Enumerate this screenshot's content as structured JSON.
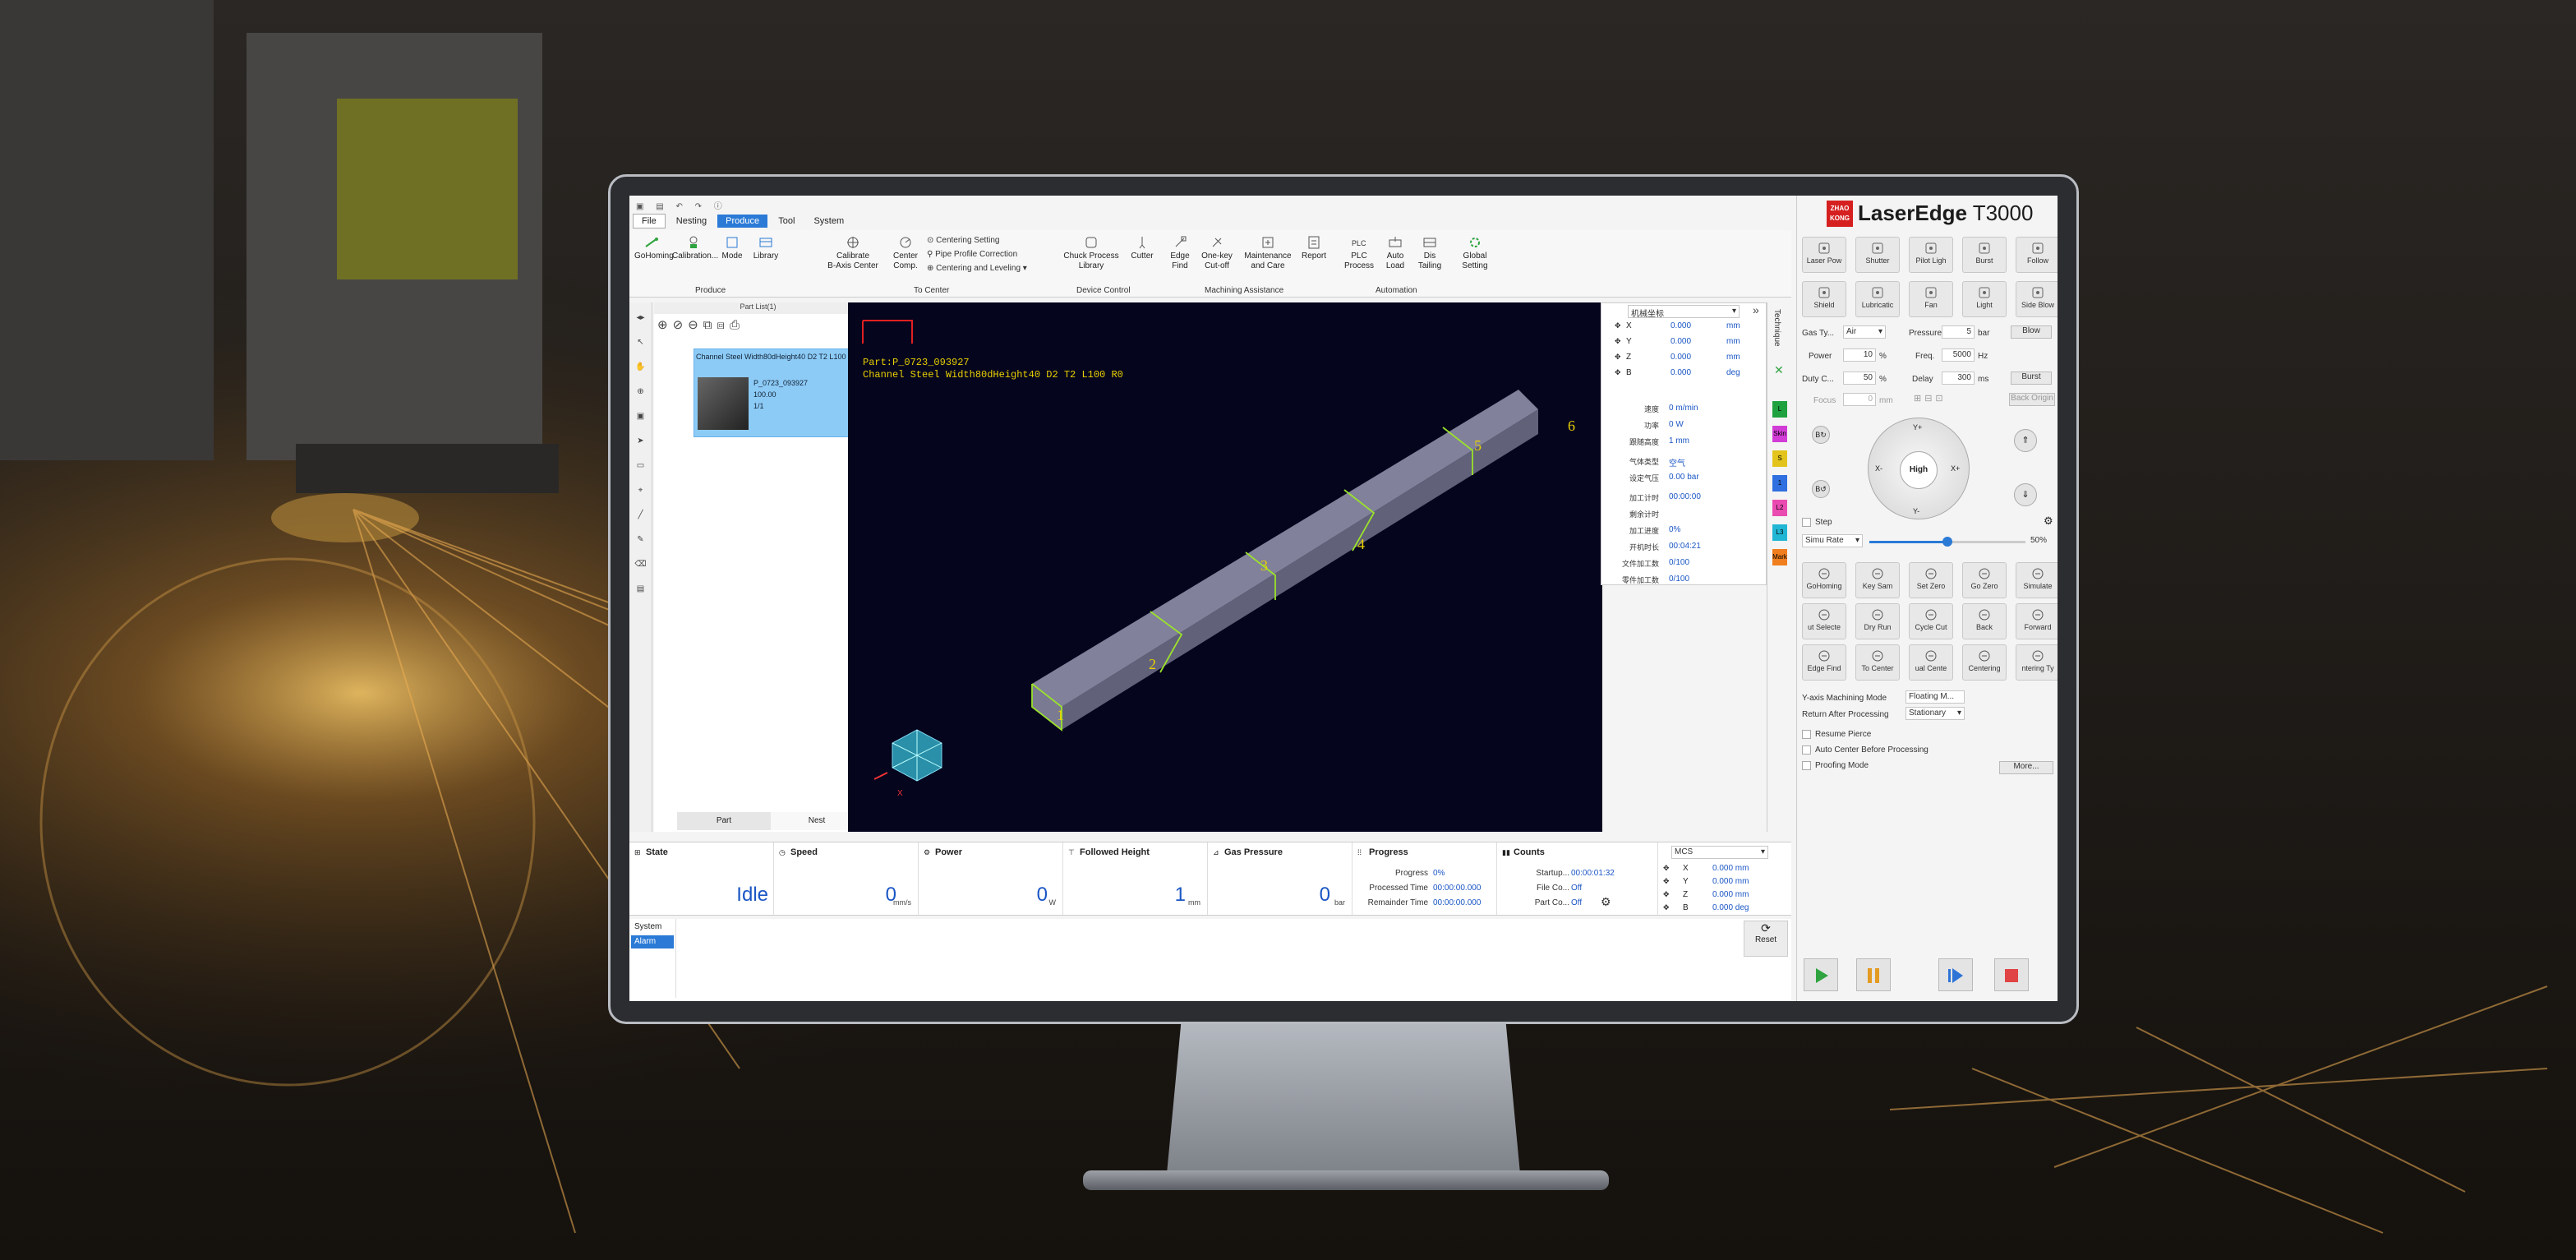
{
  "branding": {
    "brand_badge": "ZHAO KONG",
    "product_name": "LaserEdge",
    "product_model": "T3000"
  },
  "menu": [
    "File",
    "Nesting",
    "Produce",
    "Tool",
    "System"
  ],
  "active_menu": "Produce",
  "ribbon": {
    "produce": [
      {
        "label": "GoHoming",
        "icon": "target-icon"
      },
      {
        "label": "Calibration...",
        "icon": "calibration-icon"
      },
      {
        "label": "Mode",
        "icon": "mode-icon"
      },
      {
        "label": "Library",
        "icon": "library-icon"
      }
    ],
    "produce_group": "Produce",
    "center": [
      {
        "label": "Calibrate\nB-Axis Center",
        "icon": "crosshair-icon"
      },
      {
        "label": "Center\nComp.",
        "icon": "center-comp-icon"
      }
    ],
    "center_small": [
      "Centering Setting",
      "Pipe Profile Correction",
      "Centering and Leveling"
    ],
    "center_group": "To Center",
    "device": [
      {
        "label": "Chuck Process\nLibrary",
        "icon": "chuck-icon"
      },
      {
        "label": "Cutter",
        "icon": "cutter-icon"
      }
    ],
    "device_group": "Device Control",
    "assist": [
      {
        "label": "Edge\nFind",
        "icon": "edge-find-icon"
      },
      {
        "label": "One-key\nCut-off",
        "icon": "cutoff-icon"
      },
      {
        "label": "Maintenance\nand Care",
        "icon": "maintenance-icon"
      },
      {
        "label": "Report",
        "icon": "report-icon"
      }
    ],
    "assist_group": "Machining Assistance",
    "auto": [
      {
        "label": "PLC\nProcess",
        "icon": "plc-text-icon"
      },
      {
        "label": "Auto\nLoad",
        "icon": "auto-load-icon"
      },
      {
        "label": "Dis\nTailing",
        "icon": "tailing-icon"
      }
    ],
    "auto_group": "Automation",
    "global": {
      "label": "Global\nSetting",
      "icon": "gear-icon"
    }
  },
  "part_list": {
    "title": "Part List(1)",
    "item_name": "Channel Steel Width80dHeight40 D2 T2 L100 R0",
    "item_id": "P_0723_093927",
    "item_qty": "100.00",
    "item_count": "1/1",
    "tab_part": "Part",
    "tab_nest": "Nest"
  },
  "canvas": {
    "part_label": "Part:P_0723_093927",
    "part_desc": "Channel Steel Width80dHeight40 D2 T2 L100 R0",
    "segments": [
      "1",
      "2",
      "3",
      "4",
      "5",
      "6"
    ]
  },
  "coords_panel": {
    "dropdown": "机械坐标",
    "axes": [
      {
        "a": "X",
        "v": "0.000",
        "u": "mm"
      },
      {
        "a": "Y",
        "v": "0.000",
        "u": "mm"
      },
      {
        "a": "Z",
        "v": "0.000",
        "u": "mm"
      },
      {
        "a": "B",
        "v": "0.000",
        "u": "deg"
      }
    ],
    "params": [
      {
        "k": "速度",
        "v": "0 m/min"
      },
      {
        "k": "功率",
        "v": "0 W"
      },
      {
        "k": "跟随高度",
        "v": "1 mm"
      },
      {
        "k": "气体类型",
        "v": "空气"
      },
      {
        "k": "设定气压",
        "v": "0.00 bar"
      },
      {
        "k": "加工计时",
        "v": "00:00:00"
      },
      {
        "k": "剩余计时",
        "v": ""
      },
      {
        "k": "加工进度",
        "v": "0%"
      },
      {
        "k": "开机时长",
        "v": "00:04:21"
      },
      {
        "k": "文件加工数",
        "v": "0/100"
      },
      {
        "k": "零件加工数",
        "v": "0/100"
      }
    ]
  },
  "side_tabs": {
    "technique": "Technique",
    "layers": [
      "L",
      "Skin",
      "S",
      "1",
      "L2",
      "L3",
      "Mark"
    ],
    "layer_colors": [
      "#1fa13f",
      "#d23cd6",
      "#e3c41c",
      "#2f6fe0",
      "#ea4bb0",
      "#21b6d4",
      "#f07e1e"
    ]
  },
  "status": {
    "state": {
      "t": "State",
      "v": "Idle"
    },
    "speed": {
      "t": "Speed",
      "v": "0",
      "u": "mm/s"
    },
    "power": {
      "t": "Power",
      "v": "0",
      "u": "W"
    },
    "followed": {
      "t": "Followed Height",
      "v": "1",
      "u": "mm"
    },
    "gas": {
      "t": "Gas Pressure",
      "v": "0",
      "u": "bar"
    },
    "progress": {
      "t": "Progress",
      "rows": [
        {
          "k": "Progress",
          "v": "0%"
        },
        {
          "k": "Processed Time",
          "v": "00:00:00.000"
        },
        {
          "k": "Remainder Time",
          "v": "00:00:00.000"
        }
      ]
    },
    "counts": {
      "t": "Counts",
      "rows": [
        {
          "k": "Startup...",
          "v": "00:00:01:32"
        },
        {
          "k": "File Co...",
          "v": "Off"
        },
        {
          "k": "Part Co...",
          "v": "Off"
        }
      ]
    },
    "mcs": {
      "dropdown": "MCS",
      "axes": [
        {
          "a": "X",
          "v": "0.000 mm"
        },
        {
          "a": "Y",
          "v": "0.000 mm"
        },
        {
          "a": "Z",
          "v": "0.000 mm"
        },
        {
          "a": "B",
          "v": "0.000 deg"
        }
      ]
    }
  },
  "log": {
    "tab_system": "System",
    "tab_alarm": "Alarm",
    "reset": "Reset"
  },
  "right": {
    "row1": [
      "Laser Pow",
      "Shutter",
      "Pilot Ligh",
      "Burst",
      "Follow"
    ],
    "row2": [
      "Shield",
      "Lubricatic",
      "Fan",
      "Light",
      "Side Blow"
    ],
    "gas_label": "Gas Ty...",
    "gas_value": "Air",
    "pressure_label": "Pressure",
    "pressure_value": "5",
    "pressure_unit": "bar",
    "blow": "Blow",
    "power_label": "Power",
    "power_value": "10",
    "power_unit": "%",
    "freq_label": "Freq.",
    "freq_value": "5000",
    "freq_unit": "Hz",
    "duty_label": "Duty C...",
    "duty_value": "50",
    "duty_unit": "%",
    "delay_label": "Delay",
    "delay_value": "300",
    "delay_unit": "ms",
    "burst": "Burst",
    "focus_label": "Focus",
    "focus_value": "0",
    "focus_unit": "mm",
    "back_origin": "Back Origin",
    "jog": {
      "up": "Y+",
      "down": "Y-",
      "left": "X-",
      "right": "X+",
      "center": "High",
      "b1": "B",
      "b2": "B"
    },
    "step": "Step",
    "simu": "Simu Rate",
    "simu_pct": "50%",
    "simu_level": 0.5,
    "grid": [
      [
        "GoHoming",
        "Key Sam",
        "Set Zero",
        "Go Zero",
        "Simulate"
      ],
      [
        "ut Selecte",
        "Dry Run",
        "Cycle Cut",
        "Back",
        "Forward"
      ],
      [
        "Edge Find",
        "To Center",
        "ual Cente",
        "Centering",
        "ntering Ty"
      ]
    ],
    "yaxis_label": "Y-axis Machining Mode",
    "yaxis_value": "Floating M...",
    "return_label": "Return After Processing",
    "return_value": "Stationary",
    "checks": [
      "Resume Pierce",
      "Auto Center Before Processing",
      "Proofing Mode"
    ],
    "more": "More..."
  },
  "colors": {
    "play": "#2fa33f",
    "pause": "#e39b22",
    "step": "#2d74d6",
    "stop": "#e04444",
    "accent": "#2a7ad6"
  }
}
